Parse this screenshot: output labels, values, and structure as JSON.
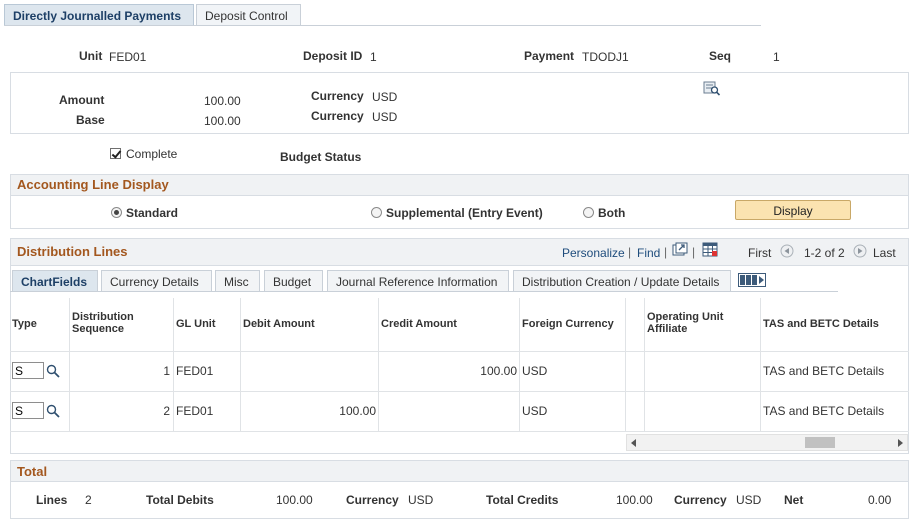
{
  "tabs": [
    {
      "label": "Directly Journalled Payments",
      "active": true
    },
    {
      "label": "Deposit Control",
      "active": false
    }
  ],
  "header": {
    "unit_label": "Unit",
    "unit_value": "FED01",
    "deposit_id_label": "Deposit ID",
    "deposit_id_value": "1",
    "payment_label": "Payment",
    "payment_value": "TDODJ1",
    "seq_label": "Seq",
    "seq_value": "1"
  },
  "amounts": {
    "amount_label": "Amount",
    "amount_value": "100.00",
    "amount_currency_label": "Currency",
    "amount_currency_value": "USD",
    "base_label": "Base",
    "base_value": "100.00",
    "base_currency_label": "Currency",
    "base_currency_value": "USD"
  },
  "status": {
    "complete_label": "Complete",
    "complete_checked": true,
    "budget_status_label": "Budget Status"
  },
  "accounting_display": {
    "title": "Accounting Line Display",
    "options": [
      {
        "label": "Standard",
        "selected": true
      },
      {
        "label": "Supplemental (Entry Event)",
        "selected": false
      },
      {
        "label": "Both",
        "selected": false
      }
    ],
    "display_button": "Display"
  },
  "distribution": {
    "title": "Distribution Lines",
    "personalize": "Personalize",
    "find": "Find",
    "first": "First",
    "range": "1-2 of 2",
    "last": "Last",
    "tabs": [
      {
        "label": "ChartFields",
        "active": true
      },
      {
        "label": "Currency Details",
        "active": false
      },
      {
        "label": "Misc",
        "active": false
      },
      {
        "label": "Budget",
        "active": false
      },
      {
        "label": "Journal Reference Information",
        "active": false
      },
      {
        "label": "Distribution Creation / Update Details",
        "active": false
      }
    ],
    "columns": {
      "type": "Type",
      "dist_seq": "Distribution Sequence",
      "gl_unit": "GL Unit",
      "debit": "Debit Amount",
      "credit": "Credit Amount",
      "foreign_currency": "Foreign Currency",
      "operating_unit": "Operating Unit Affiliate",
      "tas": "TAS and BETC Details"
    },
    "rows": [
      {
        "type": "S",
        "seq": "1",
        "gl_unit": "FED01",
        "debit": "",
        "credit": "100.00",
        "foreign_currency": "USD",
        "operating_unit": "",
        "tas": "TAS and BETC Details"
      },
      {
        "type": "S",
        "seq": "2",
        "gl_unit": "FED01",
        "debit": "100.00",
        "credit": "",
        "foreign_currency": "USD",
        "operating_unit": "",
        "tas": "TAS and BETC Details"
      }
    ]
  },
  "total": {
    "title": "Total",
    "lines_label": "Lines",
    "lines_value": "2",
    "debits_label": "Total Debits",
    "debits_value": "100.00",
    "debits_currency_label": "Currency",
    "debits_currency_value": "USD",
    "credits_label": "Total Credits",
    "credits_value": "100.00",
    "credits_currency_label": "Currency",
    "credits_currency_value": "USD",
    "net_label": "Net",
    "net_value": "0.00"
  }
}
